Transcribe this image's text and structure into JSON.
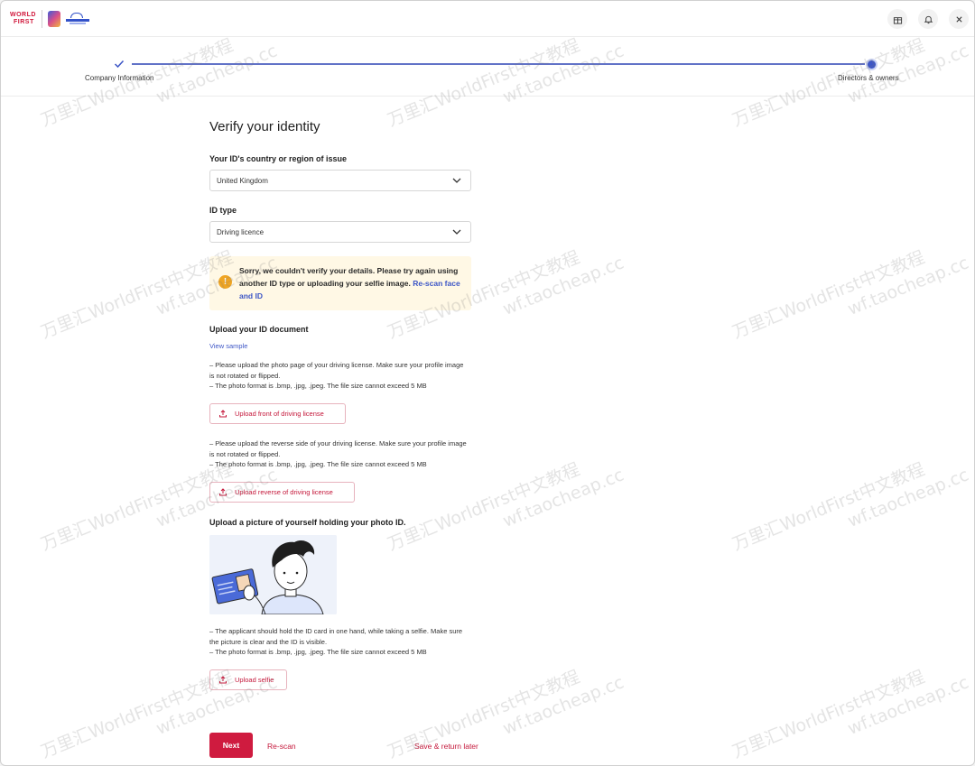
{
  "brand": {
    "logo_line1": "WORLD",
    "logo_line2": "FIRST"
  },
  "stepper": {
    "step1_label": "Company Information",
    "step2_label": "Directors & owners"
  },
  "page": {
    "title": "Verify your identity"
  },
  "country": {
    "label": "Your ID's country or region of issue",
    "value": "United Kingdom"
  },
  "id_type": {
    "label": "ID type",
    "value": "Driving licence"
  },
  "alert": {
    "icon": "!",
    "text": "Sorry, we couldn't verify your details. Please try again using another ID type or uploading your selfie image. ",
    "link": "Re-scan face and ID"
  },
  "id_document": {
    "title": "Upload your ID document",
    "view_sample": "View sample",
    "front_info_1": "– Please upload the photo page of your driving license. Make sure your profile image is not rotated or flipped.",
    "front_info_2": "– The photo format is .bmp, .jpg, .jpeg. The file size cannot exceed 5 MB",
    "front_button": "Upload front of driving license",
    "reverse_info_1": "– Please upload the reverse side of your driving license. Make sure your profile image is not rotated or flipped.",
    "reverse_info_2": "– The photo format is .bmp, .jpg, .jpeg. The file size cannot exceed 5 MB",
    "reverse_button": "Upload reverse of driving license"
  },
  "selfie": {
    "title": "Upload a picture of yourself holding your photo ID.",
    "info_1": "– The applicant should hold the ID card in one hand, while taking a selfie. Make sure the picture is clear and the ID is visible.",
    "info_2": "– The photo format is .bmp, .jpg, .jpeg. The file size cannot exceed 5 MB",
    "button": "Upload selfie"
  },
  "footer": {
    "next": "Next",
    "rescan": "Re-scan",
    "save": "Save & return later"
  },
  "watermark": {
    "line1": "万里汇WorldFirst中文教程",
    "line2": "wf.taocheap.cc"
  },
  "colors": {
    "brand_red": "#cf1b3f",
    "link_blue": "#3d56c6",
    "alert_bg": "#fff8e5",
    "alert_icon": "#f0a523"
  }
}
